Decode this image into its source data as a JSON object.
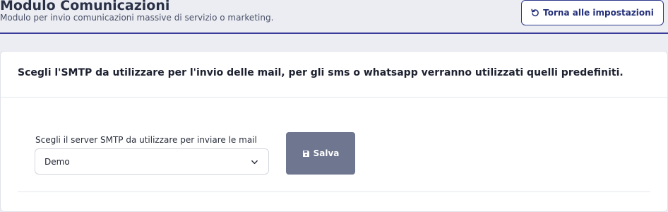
{
  "header": {
    "title": "Modulo Comunicazioni",
    "subtitle": "Modulo per invio comunicazioni massive di servizio o marketing.",
    "back_button_label": "Torna alle impostazioni",
    "back_button_icon": "undo-icon"
  },
  "card": {
    "title": "Scegli l'SMTP da utilizzare per l'invio delle mail, per gli sms o whatsapp verranno utilizzati quelli predefiniti.",
    "smtp_field": {
      "label": "Scegli il server SMTP da utilizzare per inviare le mail",
      "selected_value": "Demo"
    },
    "save_button": {
      "label": "Salva",
      "icon": "save-icon"
    }
  },
  "colors": {
    "accent": "#2e3a8c",
    "save_button_bg": "#6e7690",
    "page_bg": "#ebedf2"
  }
}
